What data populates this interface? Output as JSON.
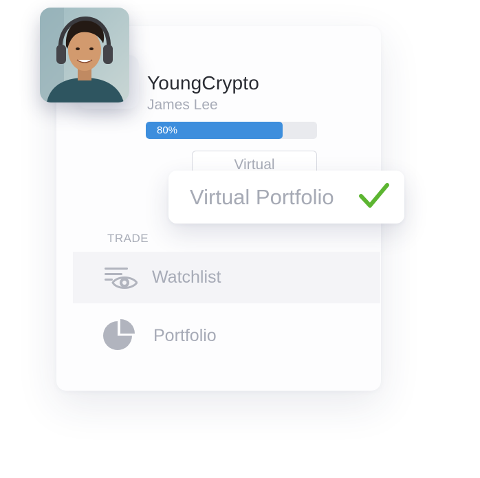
{
  "profile": {
    "username": "YoungCrypto",
    "full_name": "James Lee",
    "progress": {
      "percent": 80,
      "label": "80%"
    }
  },
  "mode_button": {
    "label": "Virtual"
  },
  "popup": {
    "label": "Virtual Portfolio"
  },
  "menu": {
    "section_label": "TRADE",
    "items": [
      {
        "label": "Watchlist",
        "icon": "watchlist-eye-icon",
        "active": true
      },
      {
        "label": "Portfolio",
        "icon": "pie-chart-icon",
        "active": false
      }
    ]
  },
  "colors": {
    "accent": "#3d8edd",
    "check": "#5cb531",
    "muted_text": "#a7abb7",
    "heading_text": "#2a2c33"
  }
}
